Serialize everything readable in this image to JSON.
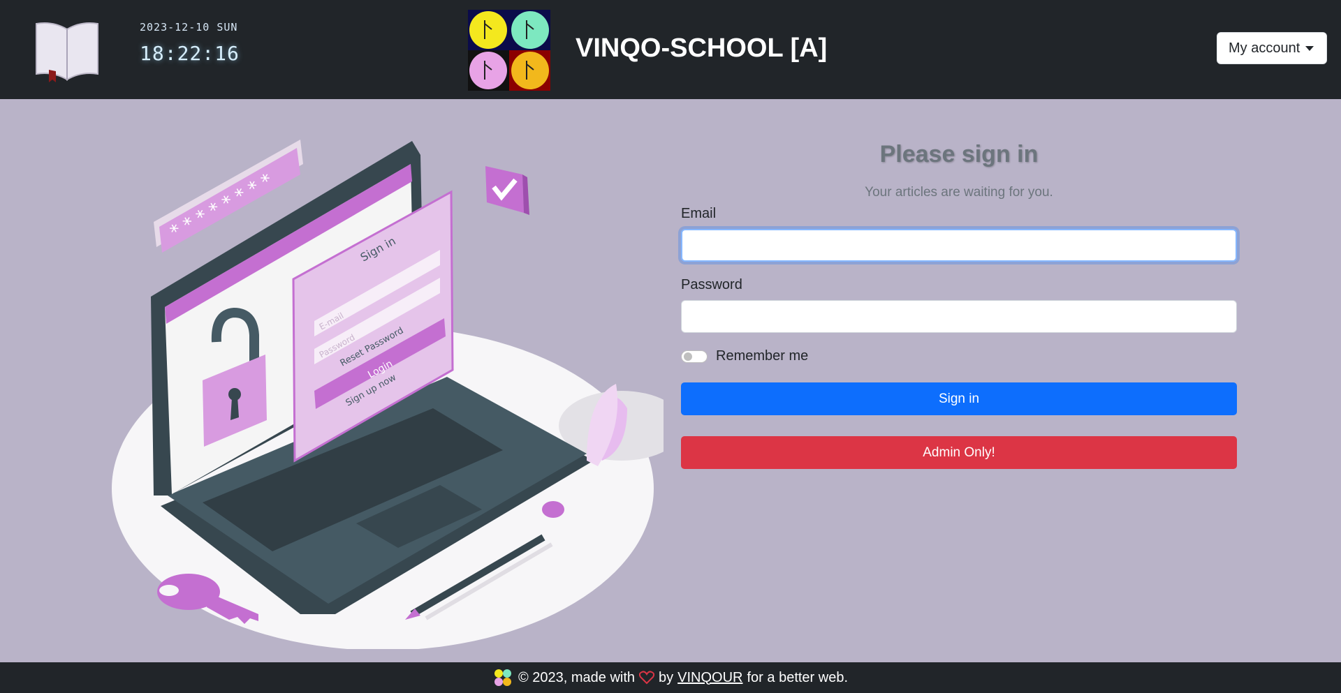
{
  "header": {
    "date": "2023-12-10 SUN",
    "time": "18:22:16",
    "brand": "VINQO-SCHOOL [A]",
    "account_label": "My account",
    "icons": {
      "left": "open-book-icon",
      "logo": "vinqo-four-leaf-logo"
    }
  },
  "illustration": {
    "signin_title": "Sign in",
    "email_placeholder": "E-mail",
    "password_placeholder": "Password",
    "reset_password": "Reset Password",
    "login_button": "Login",
    "signup": "Sign up now",
    "password_mask": "* * * * * * * *"
  },
  "form": {
    "title": "Please sign in",
    "subtitle": "Your articles are waiting for you.",
    "email_label": "Email",
    "email_value": "",
    "password_label": "Password",
    "password_value": "",
    "remember_label": "Remember me",
    "signin_button": "Sign in",
    "admin_button": "Admin Only!"
  },
  "footer": {
    "copyright": "© 2023, made with",
    "by": "by",
    "author": "VINQOUR",
    "tagline": "for a better web."
  },
  "colors": {
    "background": "#b9b3c8",
    "header": "#212529",
    "primary": "#0d6efd",
    "danger": "#dc3545",
    "accent_purple": "#c46fd1"
  }
}
